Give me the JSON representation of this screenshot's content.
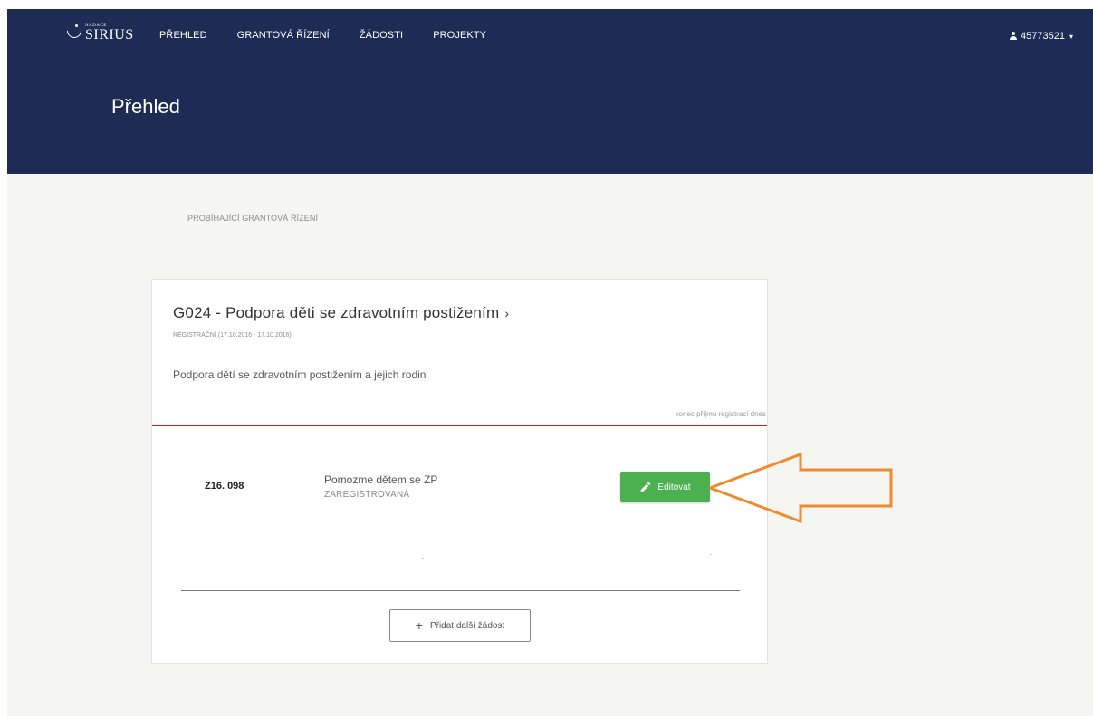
{
  "brand": {
    "small": "NADACE",
    "name": "SIRIUS"
  },
  "nav": {
    "items": [
      {
        "label": "PŘEHLED"
      },
      {
        "label": "GRANTOVÁ ŘÍZENÍ"
      },
      {
        "label": "ŽÁDOSTI"
      },
      {
        "label": "PROJEKTY"
      }
    ]
  },
  "user": {
    "id": "45773521",
    "icon": "user-icon",
    "caret": "▾"
  },
  "page": {
    "title": "Přehled"
  },
  "section": {
    "label": "PROBÍHAJÍCÍ GRANTOVÁ ŘÍZENÍ"
  },
  "grant": {
    "title": "G024 - Podpora děti se zdravotním postižením",
    "chevron": "›",
    "round": "REGISTRAČNÍ (17.10.2016 - 17.10.2016)",
    "description": "Podpora dětí se zdravotním postižením a jejich rodin",
    "deadline": "konec příjmu registrací dnes"
  },
  "application": {
    "code": "Z16. 098",
    "name": "Pomozme dětem se ZP",
    "status": "ZAREGISTROVANÁ",
    "edit_label": "Editovat"
  },
  "add_button": {
    "icon": "+",
    "label": "Přidat další žádost"
  },
  "colors": {
    "header_bg": "#1e2b55",
    "page_bg": "#f5f5f2",
    "accent_red": "#c0232c",
    "edit_green": "#4caf50",
    "annotation_orange": "#f08a2c"
  }
}
